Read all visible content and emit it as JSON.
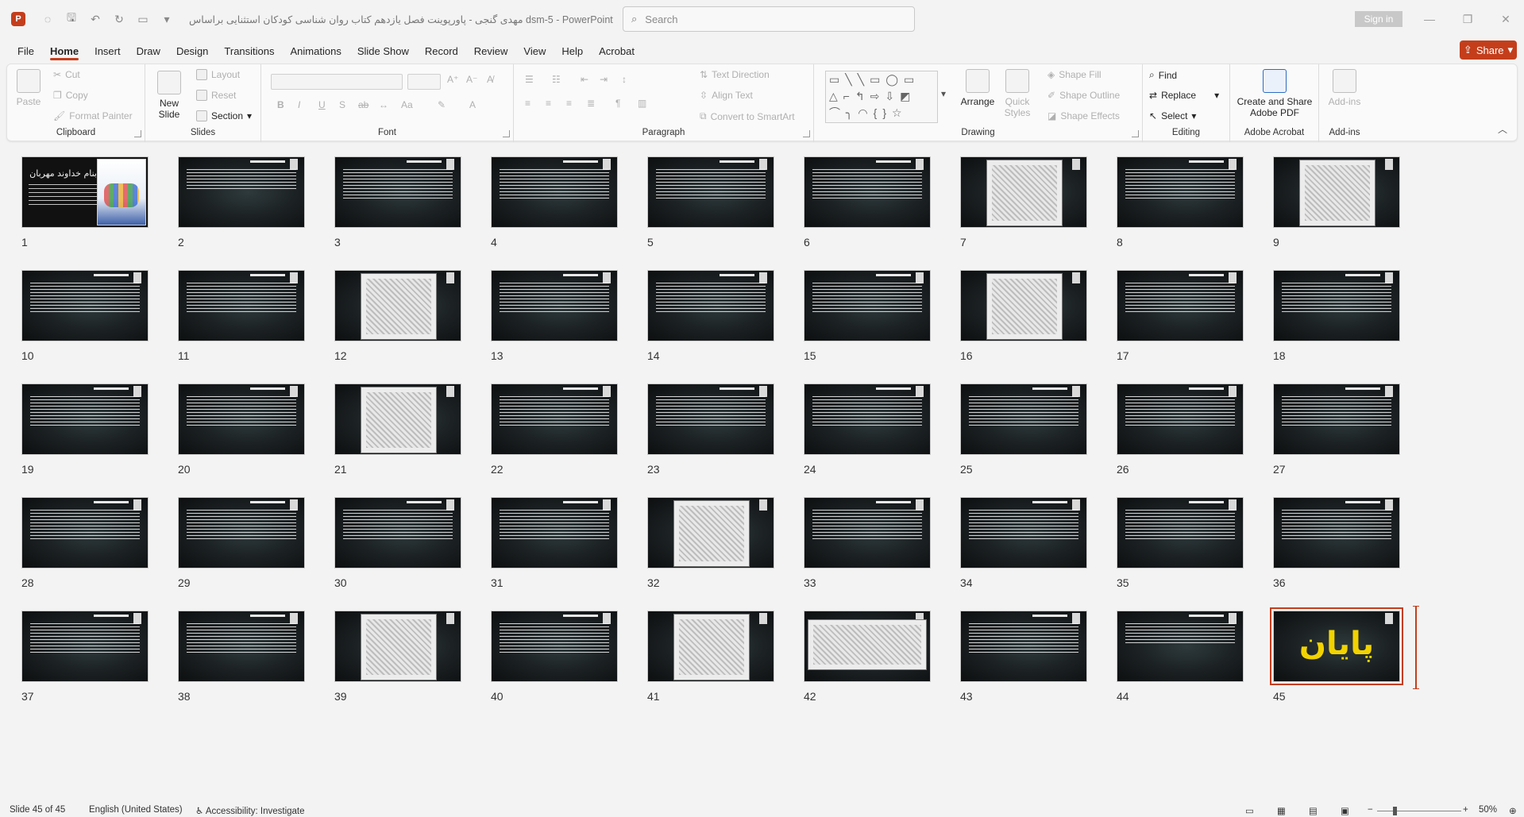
{
  "titlebar": {
    "app_letter": "P",
    "qat_icons": [
      "autosave-icon",
      "save-icon",
      "undo-icon",
      "redo-icon",
      "present-icon",
      "customize-icon"
    ],
    "doc_title": "مهدی گنجی - پاورپوینت فصل یازدهم کتاب روان شناسی کودکان استثنایی براساس dsm-5  -  PowerPoint",
    "search_placeholder": "Search",
    "sign_in": "Sign in"
  },
  "tabs": [
    "File",
    "Home",
    "Insert",
    "Draw",
    "Design",
    "Transitions",
    "Animations",
    "Slide Show",
    "Record",
    "Review",
    "View",
    "Help",
    "Acrobat"
  ],
  "active_tab": "Home",
  "share_label": "Share",
  "ribbon": {
    "clipboard": {
      "paste": "Paste",
      "cut": "Cut",
      "copy": "Copy",
      "format_painter": "Format Painter",
      "label": "Clipboard"
    },
    "slides": {
      "new_slide": "New Slide",
      "layout": "Layout",
      "reset": "Reset",
      "section": "Section",
      "label": "Slides"
    },
    "font": {
      "bold": "B",
      "italic": "I",
      "underline": "U",
      "shadow": "S",
      "strike": "ab",
      "case": "Aa",
      "label": "Font"
    },
    "paragraph": {
      "text_direction": "Text Direction",
      "align_text": "Align Text",
      "smartart": "Convert to SmartArt",
      "label": "Paragraph"
    },
    "drawing": {
      "arrange": "Arrange",
      "quick_styles": "Quick Styles",
      "shape_fill": "Shape Fill",
      "shape_outline": "Shape Outline",
      "shape_effects": "Shape Effects",
      "label": "Drawing"
    },
    "editing": {
      "find": "Find",
      "replace": "Replace",
      "select": "Select",
      "label": "Editing"
    },
    "acrobat": {
      "create_share": "Create and Share Adobe PDF",
      "label": "Adobe Acrobat"
    },
    "addins": {
      "addins": "Add-ins",
      "label": "Add-ins"
    }
  },
  "slides": [
    {
      "n": "1",
      "kind": "title"
    },
    {
      "n": "2",
      "kind": "text-short"
    },
    {
      "n": "3",
      "kind": "text"
    },
    {
      "n": "4",
      "kind": "text"
    },
    {
      "n": "5",
      "kind": "text"
    },
    {
      "n": "6",
      "kind": "text"
    },
    {
      "n": "7",
      "kind": "image"
    },
    {
      "n": "8",
      "kind": "text"
    },
    {
      "n": "9",
      "kind": "image"
    },
    {
      "n": "10",
      "kind": "text"
    },
    {
      "n": "11",
      "kind": "text"
    },
    {
      "n": "12",
      "kind": "image"
    },
    {
      "n": "13",
      "kind": "text"
    },
    {
      "n": "14",
      "kind": "text"
    },
    {
      "n": "15",
      "kind": "text"
    },
    {
      "n": "16",
      "kind": "image"
    },
    {
      "n": "17",
      "kind": "text"
    },
    {
      "n": "18",
      "kind": "text"
    },
    {
      "n": "19",
      "kind": "text"
    },
    {
      "n": "20",
      "kind": "text"
    },
    {
      "n": "21",
      "kind": "image"
    },
    {
      "n": "22",
      "kind": "text"
    },
    {
      "n": "23",
      "kind": "text"
    },
    {
      "n": "24",
      "kind": "text"
    },
    {
      "n": "25",
      "kind": "text"
    },
    {
      "n": "26",
      "kind": "text"
    },
    {
      "n": "27",
      "kind": "text"
    },
    {
      "n": "28",
      "kind": "text"
    },
    {
      "n": "29",
      "kind": "text"
    },
    {
      "n": "30",
      "kind": "text"
    },
    {
      "n": "31",
      "kind": "text"
    },
    {
      "n": "32",
      "kind": "image"
    },
    {
      "n": "33",
      "kind": "text"
    },
    {
      "n": "34",
      "kind": "text"
    },
    {
      "n": "35",
      "kind": "text"
    },
    {
      "n": "36",
      "kind": "text"
    },
    {
      "n": "37",
      "kind": "text"
    },
    {
      "n": "38",
      "kind": "text"
    },
    {
      "n": "39",
      "kind": "image"
    },
    {
      "n": "40",
      "kind": "text"
    },
    {
      "n": "41",
      "kind": "image"
    },
    {
      "n": "42",
      "kind": "image-wide"
    },
    {
      "n": "43",
      "kind": "text"
    },
    {
      "n": "44",
      "kind": "text-short"
    },
    {
      "n": "45",
      "kind": "end"
    }
  ],
  "title_slide_heading": "بنام خداوند مهربان",
  "end_slide_text": "پایان",
  "selected_slide": "45",
  "status": {
    "slide_count": "Slide 45 of 45",
    "language": "English (United States)",
    "accessibility": "Accessibility: Investigate",
    "zoom": "50%"
  },
  "colors": {
    "accent": "#c43e1c",
    "end_text": "#f2d300"
  }
}
